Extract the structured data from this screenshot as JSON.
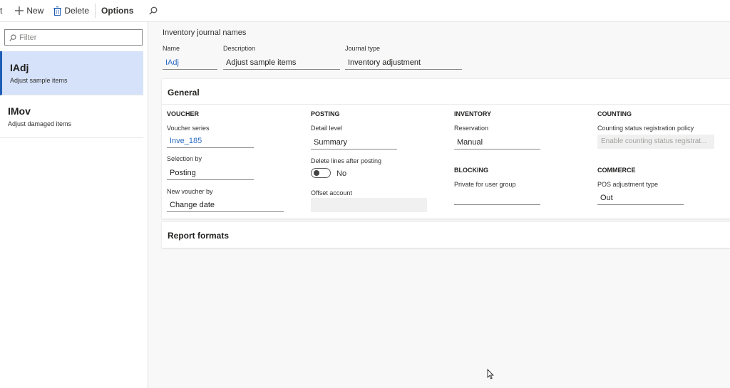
{
  "toolbar": {
    "partial_label": "t",
    "new_label": "New",
    "delete_label": "Delete",
    "options_label": "Options"
  },
  "filter": {
    "placeholder": "Filter"
  },
  "list": [
    {
      "title": "IAdj",
      "subtitle": "Adjust sample items",
      "selected": true
    },
    {
      "title": "IMov",
      "subtitle": "Adjust damaged items",
      "selected": false
    }
  ],
  "header": {
    "title": "Inventory journal names",
    "name_label": "Name",
    "name_value": "IAdj",
    "description_label": "Description",
    "description_value": "Adjust sample items",
    "journal_type_label": "Journal type",
    "journal_type_value": "Inventory adjustment"
  },
  "general": {
    "title": "General",
    "voucher": {
      "heading": "VOUCHER",
      "series_label": "Voucher series",
      "series_value": "Inve_185",
      "selection_label": "Selection by",
      "selection_value": "Posting",
      "new_voucher_label": "New voucher by",
      "new_voucher_value": "Change date"
    },
    "posting": {
      "heading": "POSTING",
      "detail_label": "Detail level",
      "detail_value": "Summary",
      "delete_lines_label": "Delete lines after posting",
      "delete_lines_value": "No",
      "offset_label": "Offset account",
      "offset_value": ""
    },
    "inventory": {
      "heading": "INVENTORY",
      "reservation_label": "Reservation",
      "reservation_value": "Manual"
    },
    "blocking": {
      "heading": "BLOCKING",
      "private_label": "Private for user group",
      "private_value": ""
    },
    "counting": {
      "heading": "COUNTING",
      "policy_label": "Counting status registration policy",
      "policy_value": "Enable counting status registrat..."
    },
    "commerce": {
      "heading": "COMMERCE",
      "pos_label": "POS adjustment type",
      "pos_value": "Out"
    }
  },
  "report_formats": {
    "title": "Report formats"
  },
  "colors": {
    "accent": "#1d5db6",
    "selected_bg": "#d5e2f9",
    "link": "#2b6cc4"
  }
}
